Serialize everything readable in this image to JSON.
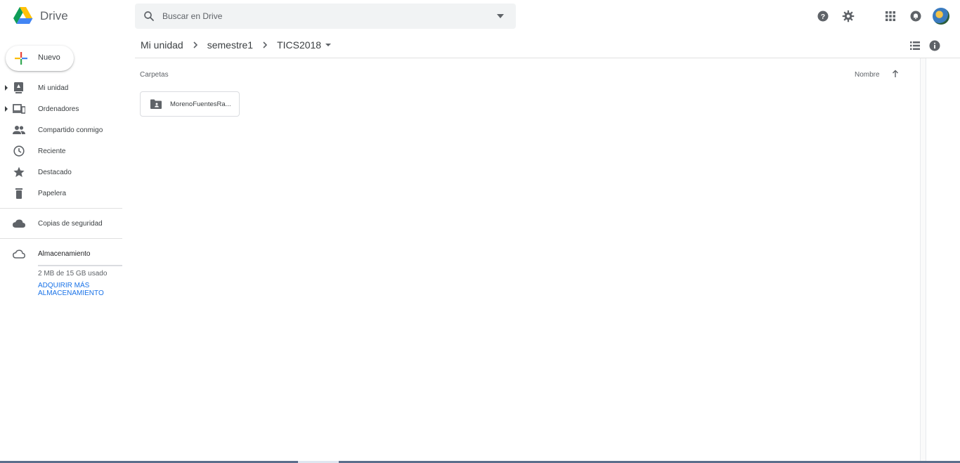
{
  "header": {
    "app_name": "Drive",
    "search_placeholder": "Buscar en Drive"
  },
  "breadcrumb": {
    "items": [
      "Mi unidad",
      "semestre1",
      "TICS2018"
    ]
  },
  "sidebar": {
    "new_button": "Nuevo",
    "items": [
      {
        "label": "Mi unidad",
        "icon": "my-drive-icon"
      },
      {
        "label": "Ordenadores",
        "icon": "computers-icon"
      },
      {
        "label": "Compartido conmigo",
        "icon": "shared-icon"
      },
      {
        "label": "Reciente",
        "icon": "clock-icon"
      },
      {
        "label": "Destacado",
        "icon": "star-icon"
      },
      {
        "label": "Papelera",
        "icon": "trash-icon"
      },
      {
        "label": "Copias de seguridad",
        "icon": "cloud-icon"
      },
      {
        "label": "Almacenamiento",
        "icon": "cloud-outline-icon"
      }
    ],
    "storage_used_text": "2 MB de 15 GB usado",
    "storage_used_fraction": 0.0001,
    "storage_link": "ADQUIRIR MÁS ALMACENAMIENTO"
  },
  "main": {
    "section_label": "Carpetas",
    "sort_label": "Nombre",
    "folders": [
      {
        "name": "MorenoFuentesRa..."
      }
    ]
  },
  "colors": {
    "accent_blue": "#1a73e8",
    "icon_grey": "#5f6368",
    "search_bg": "#f1f3f4"
  }
}
